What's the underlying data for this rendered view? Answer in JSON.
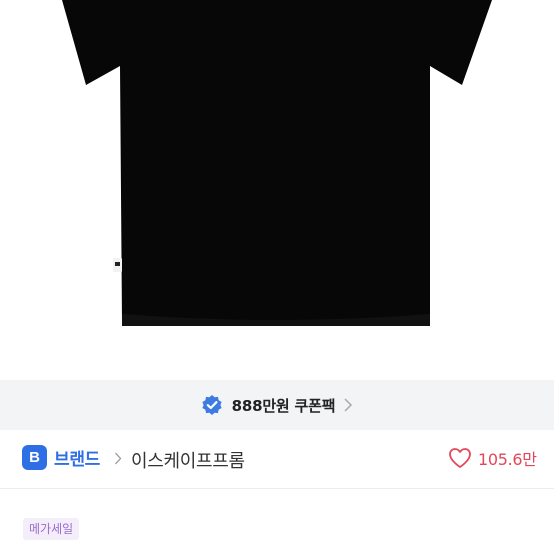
{
  "coupon": {
    "text": "888만원 쿠폰팩",
    "badge_color": "#3d7be3"
  },
  "brand": {
    "logo_letter": "B",
    "label": "브랜드",
    "store_name": "이스케이프프롬",
    "accent_color": "#2f6fe6"
  },
  "likes": {
    "count": "105.6만",
    "color": "#e2485a"
  },
  "tags": {
    "sale": "메가세일"
  },
  "icons": [
    "verified-badge-icon",
    "chevron-right-icon",
    "heart-icon"
  ]
}
